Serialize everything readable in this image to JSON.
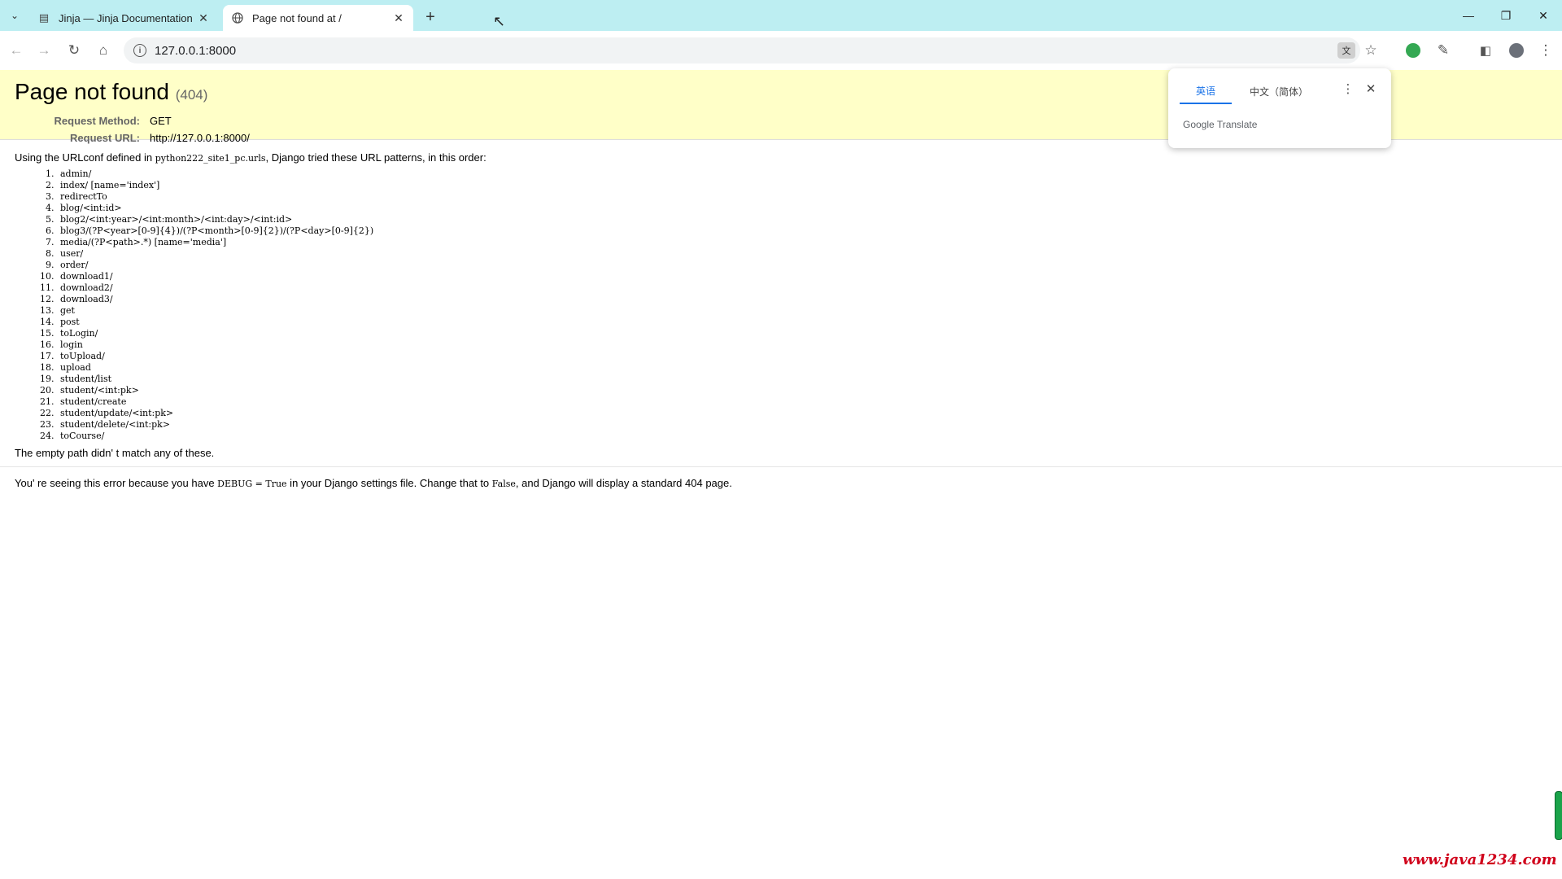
{
  "browser": {
    "tabs": [
      {
        "title": "Jinja — Jinja Documentation",
        "active": false,
        "favicon": "jinja-favicon"
      },
      {
        "title": "Page not found at /",
        "active": true,
        "favicon": "globe-icon"
      }
    ],
    "new_tab_label": "+",
    "address": "127.0.0.1:8000"
  },
  "translate_popup": {
    "source_lang": "英语",
    "target_lang": "中文（简体）",
    "brand_google": "Google",
    "brand_translate": "Translate"
  },
  "page": {
    "title": "Page not found",
    "code": "(404)",
    "request_method_label": "Request Method:",
    "request_method": "GET",
    "request_url_label": "Request URL:",
    "request_url": "http://127.0.0.1:8000/",
    "intro_before": "Using the URLconf defined in ",
    "urlconf": "python222_site1_pc.urls",
    "intro_after": ", Django tried these URL patterns, in this order:",
    "patterns": [
      "admin/",
      "index/ [name='index']",
      "redirectTo",
      "blog/<int:id>",
      "blog2/<int:year>/<int:month>/<int:day>/<int:id>",
      "blog3/(?P<year>[0-9]{4})/(?P<month>[0-9]{2})/(?P<day>[0-9]{2})",
      "media/(?P<path>.*) [name='media']",
      "user/",
      "order/",
      "download1/",
      "download2/",
      "download3/",
      "get",
      "post",
      "toLogin/",
      "login",
      "toUpload/",
      "upload",
      "student/list",
      "student/<int:pk>",
      "student/create",
      "student/update/<int:pk>",
      "student/delete/<int:pk>",
      "toCourse/"
    ],
    "no_match": "The empty path didn' t match any of these.",
    "explain_1": "You' re seeing this error because you have ",
    "explain_debug": "DEBUG = True",
    "explain_2": " in your Django settings file. Change that to ",
    "explain_false": "False",
    "explain_3": ", and Django will display a standard 404 page."
  },
  "watermark": "www.java1234.com",
  "colors": {
    "tabbar_bg": "#bdeef2",
    "summary_bg": "#ffffc8",
    "accent": "#1a73e8",
    "watermark": "#d0021b"
  }
}
